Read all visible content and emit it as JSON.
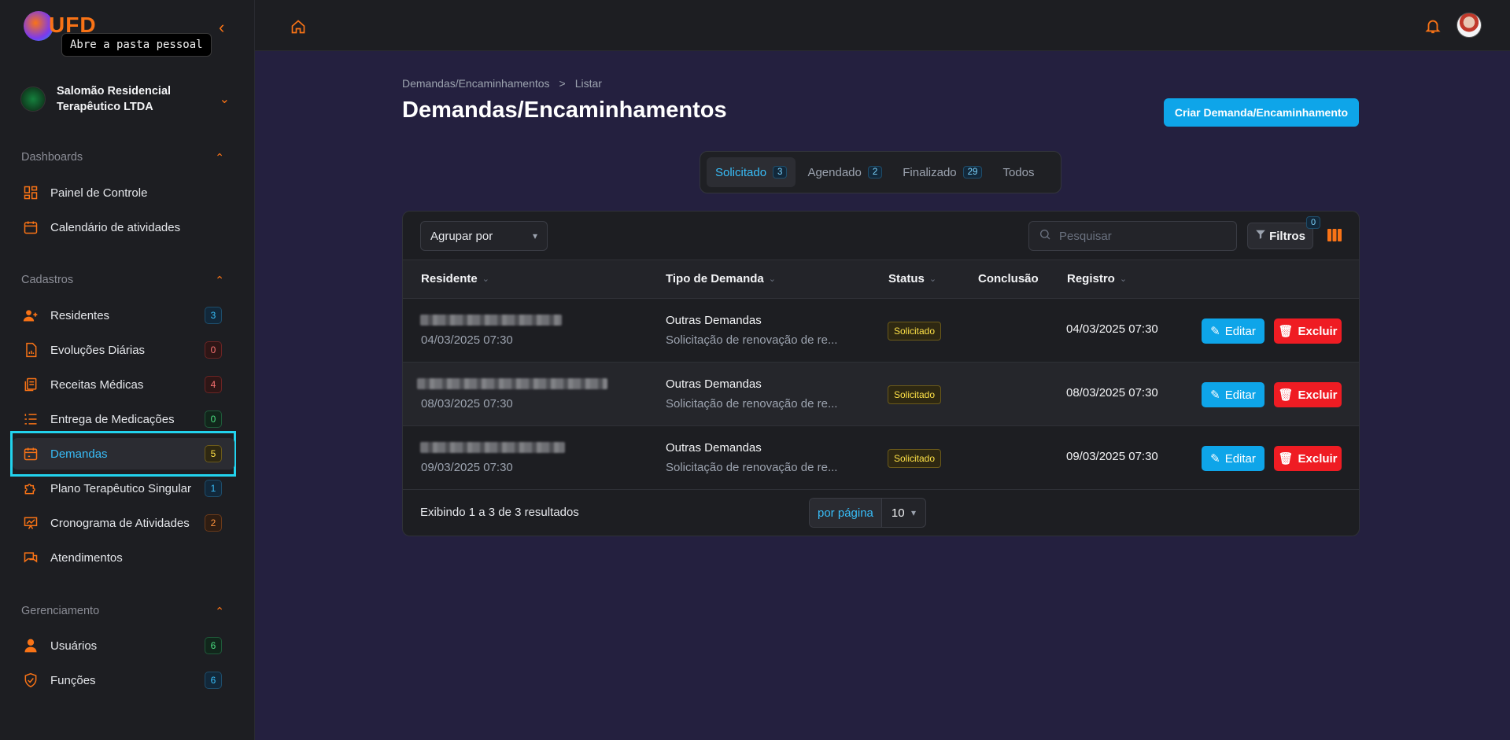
{
  "logo": {
    "text": "UFD"
  },
  "tooltip": "Abre a pasta pessoal",
  "organization": {
    "name": "Salomão Residencial Terapêutico LTDA"
  },
  "sections": {
    "dashboards": "Dashboards",
    "cadastros": "Cadastros",
    "gerenciamento": "Gerenciamento"
  },
  "nav": {
    "painel": {
      "label": "Painel de Controle"
    },
    "calendario": {
      "label": "Calendário de atividades"
    },
    "residentes": {
      "label": "Residentes",
      "count": "3"
    },
    "evolucoes": {
      "label": "Evoluções Diárias",
      "count": "0"
    },
    "receitas": {
      "label": "Receitas Médicas",
      "count": "4"
    },
    "entrega": {
      "label": "Entrega de Medicações",
      "count": "0"
    },
    "demandas": {
      "label": "Demandas",
      "count": "5"
    },
    "plano": {
      "label": "Plano Terapêutico Singular",
      "count": "1"
    },
    "cronograma": {
      "label": "Cronograma de Atividades",
      "count": "2"
    },
    "atendimentos": {
      "label": "Atendimentos"
    },
    "usuarios": {
      "label": "Usuários",
      "count": "6"
    },
    "funcoes": {
      "label": "Funções",
      "count": "6"
    }
  },
  "breadcrumb": {
    "parent": "Demandas/Encaminhamentos",
    "separator": ">",
    "current": "Listar"
  },
  "page": {
    "title": "Demandas/Encaminhamentos",
    "create_button": "Criar Demanda/Encaminhamento"
  },
  "tabs": [
    {
      "label": "Solicitado",
      "count": "3"
    },
    {
      "label": "Agendado",
      "count": "2"
    },
    {
      "label": "Finalizado",
      "count": "29"
    },
    {
      "label": "Todos"
    }
  ],
  "toolbar": {
    "group_by": "Agrupar por",
    "search_placeholder": "Pesquisar",
    "filters_label": "Filtros",
    "filters_count": "0"
  },
  "table": {
    "columns": {
      "residente": "Residente",
      "tipo": "Tipo de Demanda",
      "status": "Status",
      "conclusao": "Conclusão",
      "registro": "Registro"
    },
    "rows": [
      {
        "date": "04/03/2025 07:30",
        "type": "Outras Demandas",
        "description": "Solicitação de renovação de re...",
        "status": "Solicitado",
        "conclusion": "",
        "registro": "04/03/2025 07:30"
      },
      {
        "date": "08/03/2025 07:30",
        "type": "Outras Demandas",
        "description": "Solicitação de renovação de re...",
        "status": "Solicitado",
        "conclusion": "",
        "registro": "08/03/2025 07:30"
      },
      {
        "date": "09/03/2025 07:30",
        "type": "Outras Demandas",
        "description": "Solicitação de renovação de re...",
        "status": "Solicitado",
        "conclusion": "",
        "registro": "09/03/2025 07:30"
      }
    ],
    "edit_label": "Editar",
    "delete_label": "Excluir"
  },
  "pagination": {
    "summary": "Exibindo 1 a 3 de 3 resultados",
    "per_page_label": "por página",
    "per_page_value": "10"
  }
}
